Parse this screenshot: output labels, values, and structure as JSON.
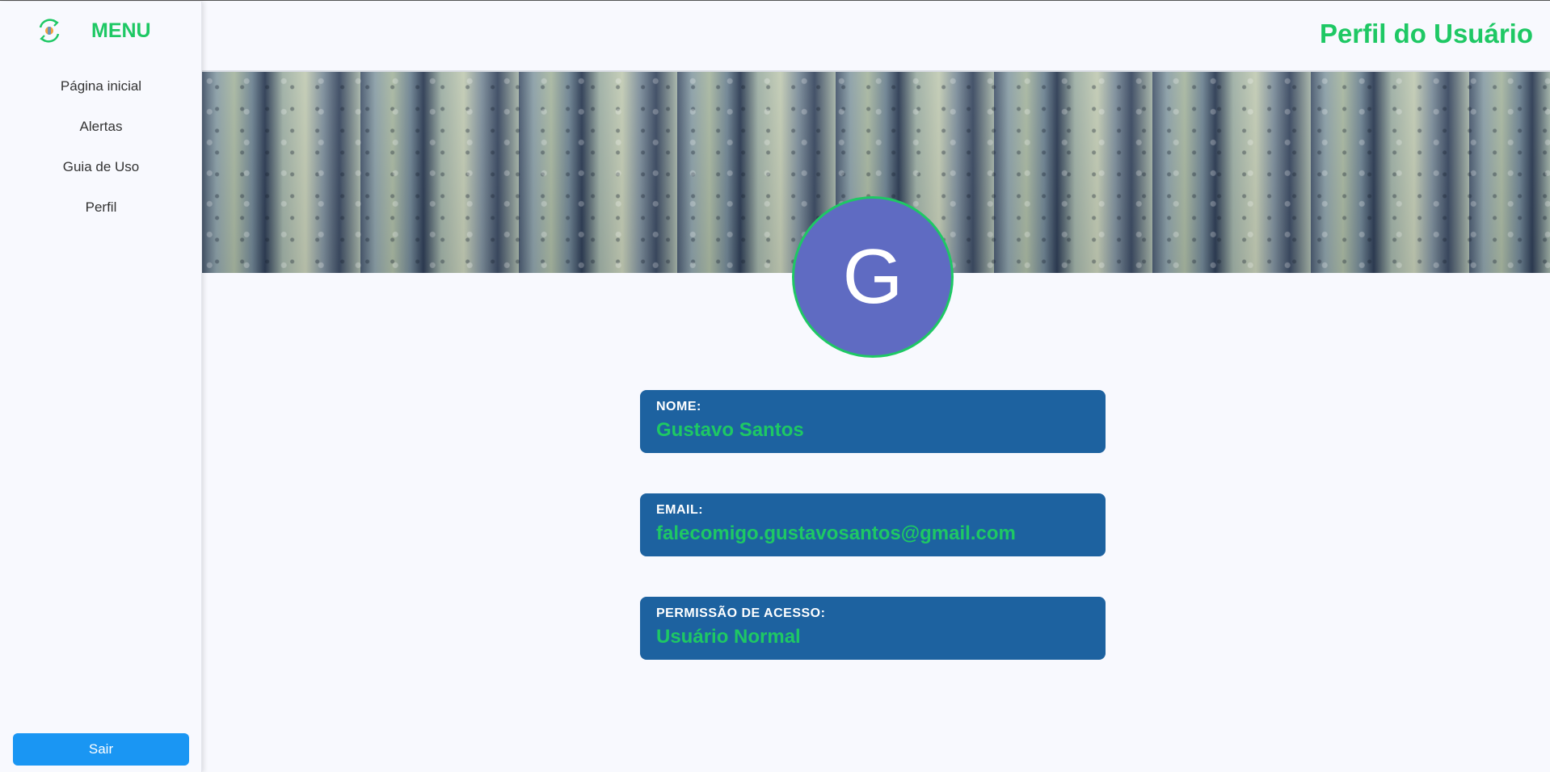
{
  "sidebar": {
    "menu_title": "MENU",
    "items": [
      {
        "label": "Página inicial"
      },
      {
        "label": "Alertas"
      },
      {
        "label": "Guia de Uso"
      },
      {
        "label": "Perfil"
      }
    ],
    "logout_label": "Sair"
  },
  "header": {
    "title": "Perfil do Usuário"
  },
  "profile": {
    "avatar_initial": "G",
    "fields": [
      {
        "label": "NOME:",
        "value": "Gustavo Santos"
      },
      {
        "label": "EMAIL:",
        "value": "falecomigo.gustavosantos@gmail.com"
      },
      {
        "label": "PERMISSÃO DE ACESSO:",
        "value": "Usuário Normal"
      }
    ]
  },
  "colors": {
    "accent_green": "#1ec864",
    "card_blue": "#1d62a0",
    "button_blue": "#1a96f3",
    "avatar_bg": "#5f6bc2"
  }
}
